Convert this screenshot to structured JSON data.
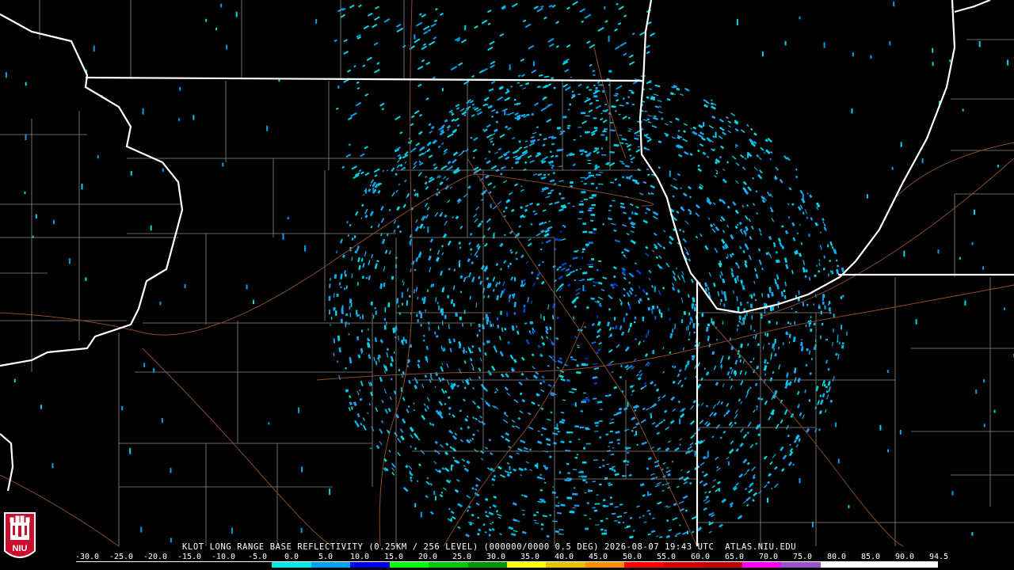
{
  "product": {
    "radar": "KLOT",
    "title": "KLOT LONG RANGE BASE REFLECTIVITY (0.25KM / 256 LEVEL) (000000/0000 0.5 DEG) 2026-08-07 19:43 UTC  ATLAS.NIU.EDU"
  },
  "logo": {
    "text": "NIU",
    "colors": {
      "shield": "#c8102e",
      "border": "#ffffff"
    }
  },
  "map": {
    "background": "#000000",
    "state_border_color": "#ffffff",
    "county_line_color": "#8a8a8a",
    "highway_color": "#8b4a2b",
    "radar_site_marker": "black-dot"
  },
  "color_scale": {
    "labels": [
      "-30.0",
      "-25.0",
      "-20.0",
      "-15.0",
      "-10.0",
      "-5.0",
      "0.0",
      "5.0",
      "10.0",
      "15.0",
      "20.0",
      "25.0",
      "30.0",
      "35.0",
      "40.0",
      "45.0",
      "50.0",
      "55.0",
      "60.0",
      "65.0",
      "70.0",
      "75.0",
      "80.0",
      "85.0",
      "90.0",
      "94.5"
    ],
    "segment_colors": [
      "#000000",
      "#000000",
      "#000000",
      "#000000",
      "#000000",
      "#00e8e8",
      "#00a0f0",
      "#0000f0",
      "#00ff00",
      "#00c800",
      "#009000",
      "#ffff00",
      "#e7c000",
      "#ff9000",
      "#ff0000",
      "#d60000",
      "#c00000",
      "#ff00ff",
      "#9955c9",
      "#ffffff",
      "#ffffff",
      "#ffffff"
    ]
  }
}
